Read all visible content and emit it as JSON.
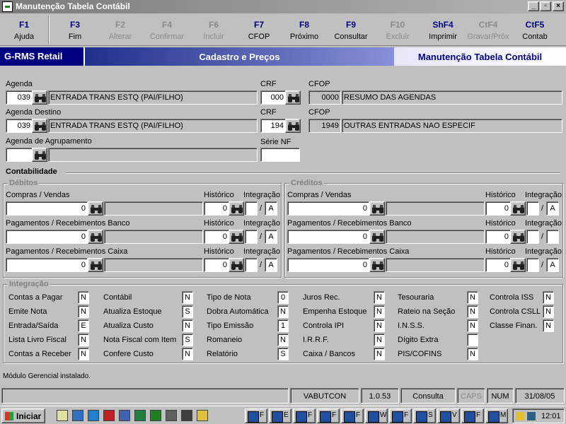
{
  "window": {
    "title": "Manutenção Tabela Contábil"
  },
  "fkeys": [
    {
      "key": "F1",
      "label": "Ajuda",
      "enabled": true
    },
    {
      "key": "F3",
      "label": "Fim",
      "enabled": true
    },
    {
      "key": "F2",
      "label": "Alterar",
      "enabled": false
    },
    {
      "key": "F4",
      "label": "Confirmar",
      "enabled": false
    },
    {
      "key": "F6",
      "label": "Incluir",
      "enabled": false
    },
    {
      "key": "F7",
      "label": "CFOP",
      "enabled": true
    },
    {
      "key": "F8",
      "label": "Próximo",
      "enabled": true
    },
    {
      "key": "F9",
      "label": "Consultar",
      "enabled": true
    },
    {
      "key": "F10",
      "label": "Excluir",
      "enabled": false
    },
    {
      "key": "ShF4",
      "label": "Imprimir",
      "enabled": true
    },
    {
      "key": "CtF4",
      "label": "Gravar/Próx",
      "enabled": false
    },
    {
      "key": "CtF5",
      "label": "Contab",
      "enabled": true
    }
  ],
  "banner": {
    "brand": "G-RMS Retail",
    "module": "Cadastro e Preços",
    "screen": "Manutenção Tabela Contábil"
  },
  "form": {
    "agenda": {
      "label": "Agenda",
      "code": "039",
      "desc": "ENTRADA TRANS ESTQ (PAI/FILHO)"
    },
    "crf1": {
      "label": "CRF",
      "value": "000"
    },
    "cfop1": {
      "label": "CFOP",
      "code": "0000",
      "desc": "RESUMO DAS AGENDAS"
    },
    "agenda_destino": {
      "label": "Agenda Destino",
      "code": "039",
      "desc": "ENTRADA TRANS ESTQ (PAI/FILHO)"
    },
    "crf2": {
      "label": "CRF",
      "value": "194"
    },
    "cfop2": {
      "label": "CFOP",
      "code": "1949",
      "desc": "OUTRAS ENTRADAS NAO ESPECIF"
    },
    "agenda_agrup": {
      "label": "Agenda de Agrupamento",
      "code": "",
      "desc": ""
    },
    "serie_nf": {
      "label": "Série NF",
      "value": ""
    }
  },
  "contab": {
    "title": "Contabilidade",
    "debitos": {
      "caption": "Débitos",
      "rows": [
        {
          "label": "Compras / Vendas",
          "value": "0",
          "hist_label": "Histórico",
          "hist": "0",
          "integ_label": "Integração",
          "integ": "A"
        },
        {
          "label": "Pagamentos / Recebimentos Banco",
          "value": "0",
          "hist_label": "Histórico",
          "hist": "0",
          "integ_label": "Integração",
          "integ": "A"
        },
        {
          "label": "Pagamentos / Recebimentos Caixa",
          "value": "0",
          "hist_label": "Histórico",
          "hist": "0",
          "integ_label": "Integração",
          "integ": "A"
        }
      ]
    },
    "creditos": {
      "caption": "Créditos",
      "rows": [
        {
          "label": "Compras / Vendas",
          "value": "0",
          "hist_label": "Histórico",
          "hist": "0",
          "integ_label": "Integração",
          "integ": "A"
        },
        {
          "label": "Pagamentos / Recebimentos Banco",
          "value": "0",
          "hist_label": "Histórico",
          "hist": "0",
          "integ_label": "Integração",
          "integ": ""
        },
        {
          "label": "Pagamentos / Recebimentos Caixa",
          "value": "0",
          "hist_label": "Histórico",
          "hist": "0",
          "integ_label": "Integração",
          "integ": "A"
        }
      ]
    }
  },
  "integracao": {
    "caption": "Integração",
    "cols": [
      [
        {
          "label": "Contas a Pagar",
          "v": "N"
        },
        {
          "label": "Emite Nota",
          "v": "N"
        },
        {
          "label": "Entrada/Saída",
          "v": "E"
        },
        {
          "label": "Lista Livro Fiscal",
          "v": "N"
        },
        {
          "label": "Contas a Receber",
          "v": "N"
        }
      ],
      [
        {
          "label": "Contábil",
          "v": "N"
        },
        {
          "label": "Atualiza Estoque",
          "v": "S"
        },
        {
          "label": "Atualiza Custo",
          "v": "N"
        },
        {
          "label": "Nota Fiscal com Item",
          "v": "S"
        },
        {
          "label": "Confere Custo",
          "v": "N"
        }
      ],
      [
        {
          "label": "Tipo de Nota",
          "v": "0"
        },
        {
          "label": "Dobra Automática",
          "v": "N"
        },
        {
          "label": "Tipo Emissão",
          "v": "1"
        },
        {
          "label": "Romaneio",
          "v": "N"
        },
        {
          "label": "Relatório",
          "v": "S"
        }
      ],
      [
        {
          "label": "Juros Rec.",
          "v": "N"
        },
        {
          "label": "Empenha Estoque",
          "v": "N"
        },
        {
          "label": "Controla IPI",
          "v": "N"
        },
        {
          "label": "I.R.R.F.",
          "v": "N"
        },
        {
          "label": "Caixa / Bancos",
          "v": "N"
        }
      ],
      [
        {
          "label": "Tesouraria",
          "v": "N"
        },
        {
          "label": "Rateio na Seção",
          "v": "N"
        },
        {
          "label": "I.N.S.S.",
          "v": "N"
        },
        {
          "label": "Dígito Extra",
          "v": ""
        },
        {
          "label": "PIS/COFINS",
          "v": "N"
        }
      ],
      [
        {
          "label": "Controla ISS",
          "v": "N"
        },
        {
          "label": "Controla CSLL",
          "v": "N"
        },
        {
          "label": "Classe Finan.",
          "v": "N"
        }
      ]
    ]
  },
  "status_message": "Módulo Gerencial instalado.",
  "statusbar": {
    "user": "VABUTCON",
    "version": "1.0.53",
    "mode": "Consulta",
    "caps": "CAPS",
    "num": "NUM",
    "date": "31/08/05"
  },
  "taskbar": {
    "start": "Iniciar",
    "clock": "12:01",
    "buttons": [
      "F",
      "E",
      "F",
      "F",
      "F",
      "W",
      "F",
      "S",
      "V",
      "F",
      "M"
    ]
  }
}
